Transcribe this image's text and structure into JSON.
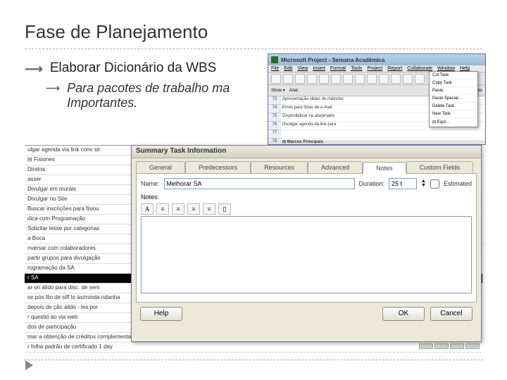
{
  "slide": {
    "title": "Fase de Planejamento",
    "bullet": "Elaborar Dicionário da WBS",
    "sub_bullet": "Para pacotes de trabalho ma",
    "sub_bullet2": "Importantes."
  },
  "project_window": {
    "title": "Microsoft Project - Semana Acadêmica",
    "menu": [
      "File",
      "Edit",
      "View",
      "Insert",
      "Format",
      "Tools",
      "Project",
      "Report",
      "Collaborate",
      "Window",
      "Help"
    ],
    "toolbar2_show": "Show ▾",
    "toolbar2_arial": "Arial",
    "toolbar2_tasks": "All Tasks",
    "rows": [
      "73",
      "74",
      "75",
      "76",
      "77",
      "78"
    ],
    "tasks": [
      "Apresentação slides de métodos",
      "Envio para listas de e-mail",
      "Disponibilizar na ata/projeto",
      "Divulgar agenda da link para",
      "",
      "⊟ Marcos Principais"
    ],
    "context_menu": [
      "Cut Task",
      "Copy Task",
      "Paste",
      "Paste Special...",
      "Delete Task",
      "New Task",
      "⊟ Eqot..."
    ]
  },
  "bg_table": {
    "rows": [
      "ulgar agenda via link conv str",
      "⊟ Fixiones",
      "Diretos",
      "asser",
      "Divulgar em murais",
      "Divulgar no Site",
      "Buscar inscrições para fisiou",
      "dica com Programação",
      "Solicitar lesse por categorias",
      "a Boca",
      "nversar com colaboradores",
      "partir grupos para divulgação",
      "rogramação da SA",
      "r SA",
      "ar on álido para disc. de sem",
      "se pós filo de siff lo ás/minda   ndanha",
      "depois de ção álido - les por",
      "r questio áo via web",
      "dos de participação",
      "mar a obtenção de créditos complementares com a JUNGRAL   0 days",
      "r folha padrão de certificado   1 day"
    ],
    "black_row_index": 13
  },
  "dialog": {
    "title": "Summary Task Information",
    "tabs": [
      "General",
      "Predecessors",
      "Resources",
      "Advanced",
      "Notes",
      "Custom Fields"
    ],
    "active_tab": "Notes",
    "name_label": "Name:",
    "name_value": "Melhorar SA",
    "duration_label": "Duration:",
    "duration_value": "25 t",
    "estimated_label": "Estimated",
    "notes_label": "Notes:",
    "toolbar_buttons": [
      "A",
      "≡",
      "≡",
      "≡",
      "≡",
      "▯"
    ],
    "help": "Help",
    "ok": "OK",
    "cancel": "Cancel"
  }
}
